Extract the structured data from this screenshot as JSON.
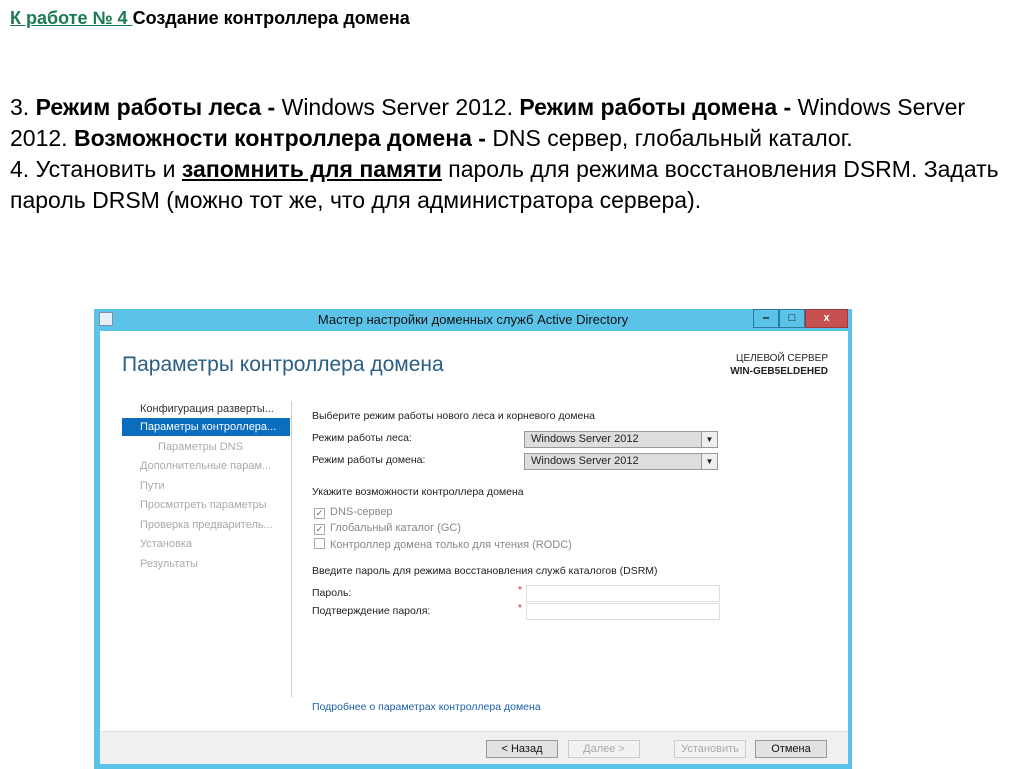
{
  "slide": {
    "heading_link": "К работе № 4 ",
    "heading_rest": "Создание контроллера домена",
    "p3_num": "3. ",
    "p3_b1": "Режим работы леса - ",
    "p3_t1": "Windows Server 2012. ",
    "p3_b2": "Режим работы домена - ",
    "p3_t2": "Windows Server 2012. ",
    "p3_b3": "Возможности контроллера домена - ",
    "p3_t3": "DNS сервер, глобальный каталог.",
    "p4_t1": "4. Установить и ",
    "p4_u": "запомнить для памяти",
    "p4_t2": " пароль для режима восстановления DSRM. Задать пароль DRSM (можно тот же, что для администратора сервера)."
  },
  "window": {
    "title": "Мастер настройки доменных служб Active Directory",
    "minimize": "‒",
    "maximize": "□",
    "close": "x",
    "page_title": "Параметры контроллера домена",
    "target_label": "ЦЕЛЕВОЙ СЕРВЕР",
    "target_server": "WIN-GEB5ELDEHED",
    "nav": [
      "Конфигурация разверты...",
      "Параметры контроллера...",
      "Параметры DNS",
      "Дополнительные парам...",
      "Пути",
      "Просмотреть параметры",
      "Проверка предваритель...",
      "Установка",
      "Результаты"
    ],
    "section1": "Выберите режим работы нового леса и корневого домена",
    "forest_label": "Режим работы леса:",
    "forest_value": "Windows Server 2012",
    "domain_label": "Режим работы домена:",
    "domain_value": "Windows Server 2012",
    "section2": "Укажите возможности контроллера домена",
    "checkboxes": [
      {
        "label": "DNS-сервер",
        "checked": true
      },
      {
        "label": "Глобальный каталог (GC)",
        "checked": true
      },
      {
        "label": "Контроллер домена только для чтения (RODC)",
        "checked": false
      }
    ],
    "section3": "Введите пароль для режима восстановления служб каталогов (DSRM)",
    "password_label": "Пароль:",
    "confirm_label": "Подтверждение пароля:",
    "required_mark": "*",
    "more_link": "Подробнее о параметрах контроллера домена",
    "buttons": {
      "back": "< Назад",
      "next": "Далее >",
      "install": "Установить",
      "cancel": "Отмена"
    },
    "check_glyph": "✓",
    "dropdown_glyph": "▼"
  }
}
